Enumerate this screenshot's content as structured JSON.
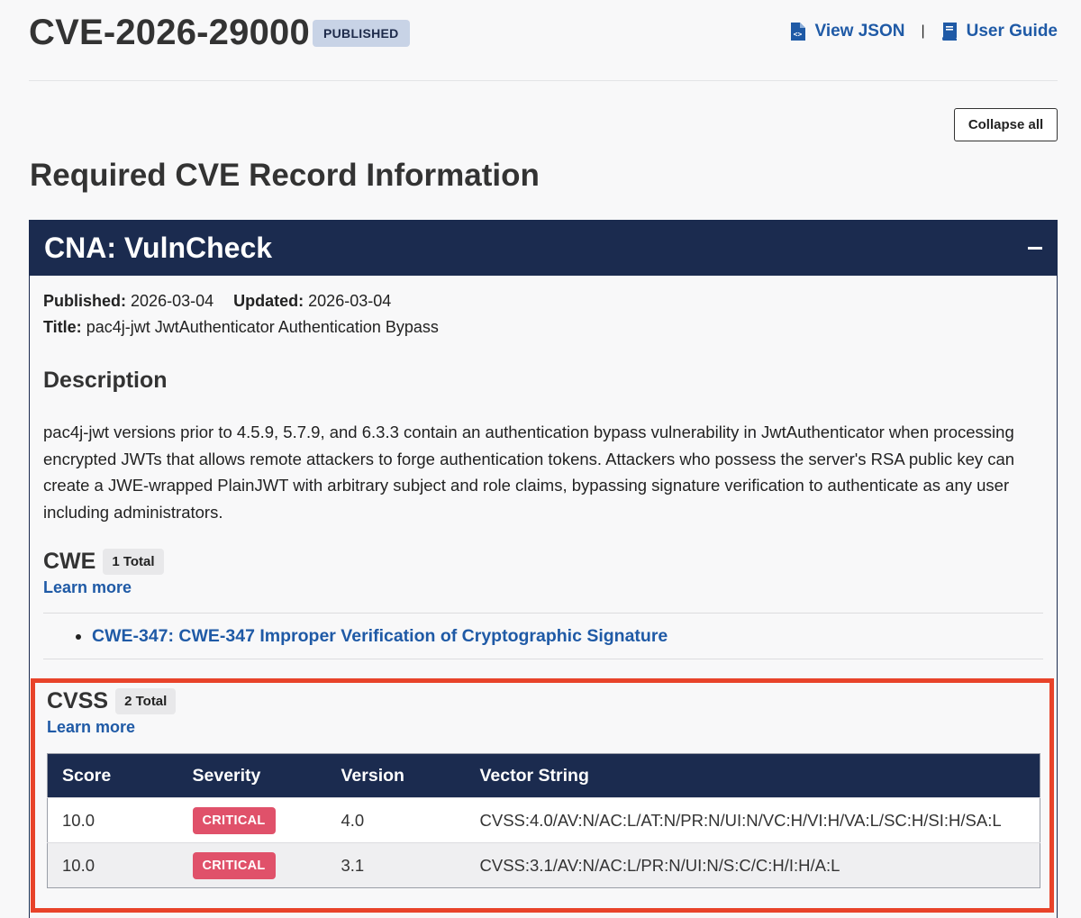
{
  "header": {
    "cve_id": "CVE-2026-29000",
    "state": "PUBLISHED",
    "view_json_label": "View JSON",
    "separator": "|",
    "user_guide_label": "User Guide",
    "link_color": "#1f5aa6"
  },
  "collapse_all_label": "Collapse all",
  "section_title": "Required CVE Record Information",
  "cna": {
    "title": "CNA: VulnCheck",
    "published_label": "Published:",
    "published_value": "2026-03-04",
    "updated_label": "Updated:",
    "updated_value": "2026-03-04",
    "title_label": "Title:",
    "title_value": "pac4j-jwt JwtAuthenticator Authentication Bypass",
    "header_color": "#1b2b4f"
  },
  "description": {
    "heading": "Description",
    "text": "pac4j-jwt versions prior to 4.5.9, 5.7.9, and 6.3.3 contain an authentication bypass vulnerability in JwtAuthenticator when processing encrypted JWTs that allows remote attackers to forge authentication tokens. Attackers who possess the server's RSA public key can create a JWE-wrapped PlainJWT with arbitrary subject and role claims, bypassing signature verification to authenticate as any user including administrators."
  },
  "cwe": {
    "heading": "CWE",
    "count": "1 Total",
    "learn_more": "Learn more",
    "items": [
      "CWE-347: CWE-347 Improper Verification of Cryptographic Signature"
    ]
  },
  "cvss": {
    "heading": "CVSS",
    "count": "2 Total",
    "learn_more": "Learn more",
    "highlight_color": "#e8432a",
    "columns": [
      "Score",
      "Severity",
      "Version",
      "Vector String"
    ],
    "rows": [
      {
        "score": "10.0",
        "severity": "CRITICAL",
        "version": "4.0",
        "vector": "CVSS:4.0/AV:N/AC:L/AT:N/PR:N/UI:N/VC:H/VI:H/VA:L/SC:H/SI:H/SA:L"
      },
      {
        "score": "10.0",
        "severity": "CRITICAL",
        "version": "3.1",
        "vector": "CVSS:3.1/AV:N/AC:L/PR:N/UI:N/S:C/C:H/I:H/A:L"
      }
    ],
    "severity_color": "#e0516a"
  }
}
